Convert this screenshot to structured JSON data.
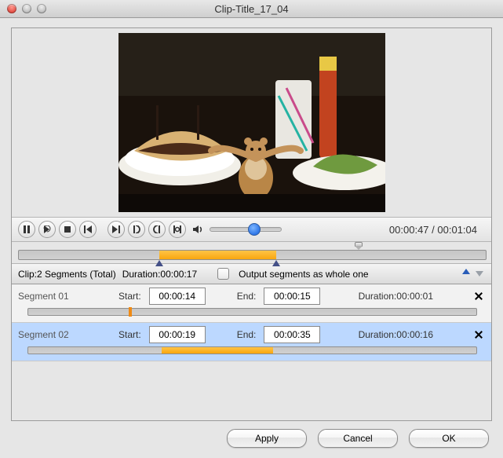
{
  "window": {
    "title": "Clip-Title_17_04"
  },
  "controls": {
    "volume_percent": 62,
    "current_time": "00:00:47",
    "total_time": "00:01:04"
  },
  "main_timeline": {
    "playhead_percent": 72.8,
    "range_start_percent": 30.0,
    "range_end_percent": 55.2
  },
  "info": {
    "clip_summary_label": "Clip:2 Segments (Total)",
    "duration_label": "Duration:",
    "duration_value": "00:00:17",
    "output_whole_label": "Output segments as whole one",
    "output_whole_checked": false
  },
  "segments": [
    {
      "name": "Segment 01",
      "start_label": "Start:",
      "start": "00:00:14",
      "end_label": "End:",
      "end": "00:00:15",
      "duration_label": "Duration:",
      "duration": "00:00:01",
      "selected": false,
      "track": {
        "marker_percent": 22.7
      }
    },
    {
      "name": "Segment 02",
      "start_label": "Start:",
      "start": "00:00:19",
      "end_label": "End:",
      "end": "00:00:35",
      "duration_label": "Duration:",
      "duration": "00:00:16",
      "selected": true,
      "track": {
        "range_start_percent": 29.7,
        "range_end_percent": 54.7
      }
    }
  ],
  "footer": {
    "apply": "Apply",
    "cancel": "Cancel",
    "ok": "OK"
  },
  "icons": {
    "pause": "pause-icon",
    "play_segment": "play-segment-icon",
    "stop": "stop-icon",
    "prev": "prev-frame-icon",
    "next": "next-frame-icon",
    "mark_in": "mark-in-icon",
    "mark_out": "mark-out-icon",
    "mark_inout": "mark-inout-icon",
    "volume": "volume-icon",
    "up_arrow": "move-up-icon",
    "down_arrow": "move-down-icon"
  }
}
